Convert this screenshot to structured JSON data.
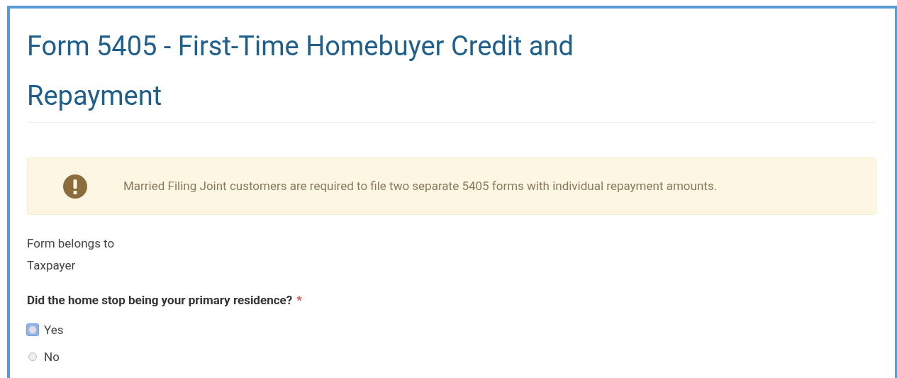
{
  "title": "Form 5405 - First-Time Homebuyer Credit and Repayment",
  "alert": {
    "kind": "warning",
    "message": "Married Filing Joint customers are required to file two separate 5405 forms with individual repayment amounts."
  },
  "owner": {
    "label": "Form belongs to",
    "value": "Taxpayer"
  },
  "question": {
    "label": "Did the home stop being your primary residence?",
    "required_mark": "*",
    "options": [
      {
        "label": "Yes",
        "selected": false,
        "focused": true
      },
      {
        "label": "No",
        "selected": false,
        "focused": false
      }
    ]
  }
}
